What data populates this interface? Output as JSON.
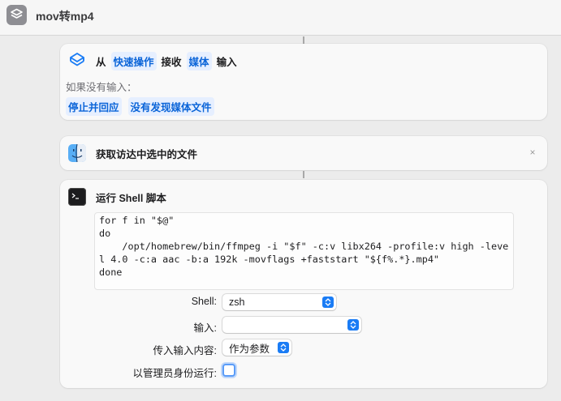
{
  "window": {
    "title": "mov转mp4"
  },
  "action1": {
    "from": "从",
    "source_token": "快速操作",
    "receive": "接收",
    "type_token": "媒体",
    "input": "输入",
    "if_none_label": "如果没有输入：",
    "stop_token": "停止并回应",
    "message_token": "没有发现媒体文件"
  },
  "action2": {
    "label": "获取访达中选中的文件",
    "close": "×"
  },
  "action3": {
    "label": "运行 Shell 脚本",
    "script": "for f in \"$@\"\ndo\n    /opt/homebrew/bin/ffmpeg -i \"$f\" -c:v libx264 -profile:v high -level 4.0 -c:a aac -b:a 192k -movflags +faststart \"${f%.*}.mp4\"\ndone",
    "params": {
      "shell_label": "Shell:",
      "shell_value": "zsh",
      "input_label": "输入:",
      "input_value": "",
      "pass_label": "传入输入内容:",
      "pass_value": "作为参数",
      "admin_label": "以管理员身份运行:"
    }
  },
  "colors": {
    "accent": "#0a64d8",
    "token_bg": "#e6efff",
    "stepper": "#1a7cf5"
  }
}
